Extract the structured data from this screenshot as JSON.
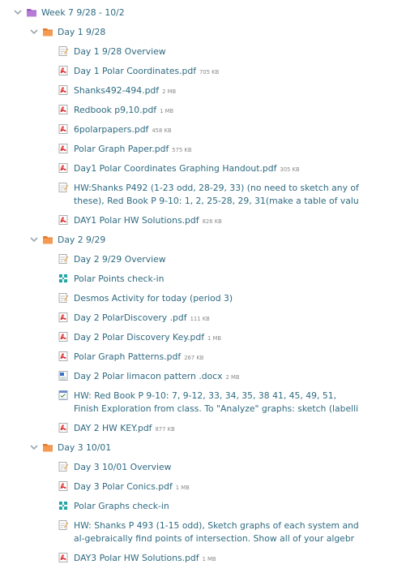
{
  "tree": {
    "week": {
      "label": "Week 7 9/28 - 10/2"
    },
    "day1": {
      "label": "Day 1 9/28",
      "items": [
        {
          "icon": "page-icon",
          "label": "Day 1 9/28 Overview",
          "size": ""
        },
        {
          "icon": "pdf-icon",
          "label": "Day 1 Polar Coordinates.pdf",
          "size": "705 KB"
        },
        {
          "icon": "pdf-icon",
          "label": "Shanks492-494.pdf",
          "size": "2 MB"
        },
        {
          "icon": "pdf-icon",
          "label": "Redbook p9,10.pdf",
          "size": "1 MB"
        },
        {
          "icon": "pdf-icon",
          "label": "6polarpapers.pdf",
          "size": "458 KB"
        },
        {
          "icon": "pdf-icon",
          "label": "Polar Graph Paper.pdf",
          "size": "575 KB"
        },
        {
          "icon": "pdf-icon",
          "label": "Day1 Polar Coordinates Graphing Handout.pdf",
          "size": "305 KB"
        },
        {
          "icon": "page-icon",
          "label": "HW:Shanks P492 (1-23 odd, 28-29, 33) (no need to sketch any of these), Red Book P 9-10: 1, 2, 25-28, 29, 31(make a table of valu",
          "size": ""
        },
        {
          "icon": "pdf-icon",
          "label": "DAY1 Polar HW Solutions.pdf",
          "size": "826 KB"
        }
      ]
    },
    "day2": {
      "label": "Day 2 9/29",
      "items": [
        {
          "icon": "page-icon",
          "label": "Day 2 9/29 Overview",
          "size": ""
        },
        {
          "icon": "puzzle-icon",
          "label": "Polar Points check-in",
          "size": ""
        },
        {
          "icon": "page-icon",
          "label": "Desmos Activity for today (period 3)",
          "size": ""
        },
        {
          "icon": "pdf-icon",
          "label": "Day 2 PolarDiscovery .pdf",
          "size": "111 KB"
        },
        {
          "icon": "pdf-icon",
          "label": "Day 2 Polar Discovery Key.pdf",
          "size": "1 MB"
        },
        {
          "icon": "pdf-icon",
          "label": "Polar Graph Patterns.pdf",
          "size": "267 KB"
        },
        {
          "icon": "word-doc-icon",
          "label": "Day 2 Polar limacon pattern .docx",
          "size": "2 MB"
        },
        {
          "icon": "assignment-icon",
          "label": "HW: Red Book P 9-10: 7, 9-12, 33, 34, 35, 38 41, 45, 49, 51, Finish Exploration from class. To \"Analyze\" graphs: sketch (labelli",
          "size": ""
        },
        {
          "icon": "pdf-icon",
          "label": "DAY 2 HW KEY.pdf",
          "size": "877 KB"
        }
      ]
    },
    "day3": {
      "label": "Day 3 10/01",
      "items": [
        {
          "icon": "page-icon",
          "label": "Day 3 10/01 Overview",
          "size": ""
        },
        {
          "icon": "pdf-icon",
          "label": "Day 3 Polar Conics.pdf",
          "size": "1 MB"
        },
        {
          "icon": "puzzle-icon",
          "label": "Polar Graphs check-in",
          "size": ""
        },
        {
          "icon": "page-icon",
          "label": "HW: Shanks P 493 (1-15 odd), Sketch graphs of each system and al-gebraically find points of intersection. Show all of your algebr",
          "size": ""
        },
        {
          "icon": "pdf-icon",
          "label": "DAY3 Polar HW Solutions.pdf",
          "size": "1 MB"
        }
      ]
    }
  },
  "colors": {
    "link": "#2e6a80",
    "folder_orange": "#f08a3c",
    "folder_purple": "#9b5cc0",
    "size_text": "#8a8a8a"
  }
}
